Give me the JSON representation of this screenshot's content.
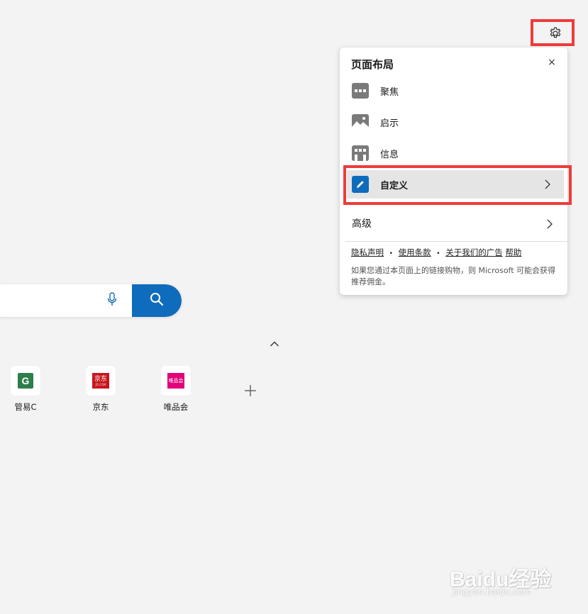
{
  "settings": {
    "icon": "gear-icon"
  },
  "layout_panel": {
    "title": "页面布局",
    "close_label": "×",
    "items": [
      {
        "label": "聚焦",
        "icon": "focused-layout-icon"
      },
      {
        "label": "启示",
        "icon": "inspirational-layout-icon"
      },
      {
        "label": "信息",
        "icon": "informational-layout-icon"
      },
      {
        "label": "自定义",
        "icon": "pencil-icon",
        "selected": true
      }
    ],
    "advanced_label": "高级",
    "links": [
      "隐私声明",
      "使用条款",
      "关于我们的广告",
      "帮助"
    ],
    "notice": "如果您通过本页面上的链接购物，则 Microsoft 可能会获得推荐佣金。"
  },
  "search": {
    "placeholder": "",
    "button_icon": "search-icon",
    "mic_icon": "microphone-icon"
  },
  "quick_links": [
    {
      "label": "管易C",
      "logo": "G"
    },
    {
      "label": "京东",
      "logo": "京东",
      "logo_sub": "JD.COM"
    },
    {
      "label": "唯品会",
      "logo": "唯品会"
    }
  ],
  "watermark": {
    "brand": "Baidu经验",
    "url": "jingyan.baidu.com"
  },
  "colors": {
    "accent": "#0f6cbd",
    "highlight": "#ef3b3b",
    "selected_row": "#e5e5e5",
    "page_bg": "#f3f3f3"
  }
}
